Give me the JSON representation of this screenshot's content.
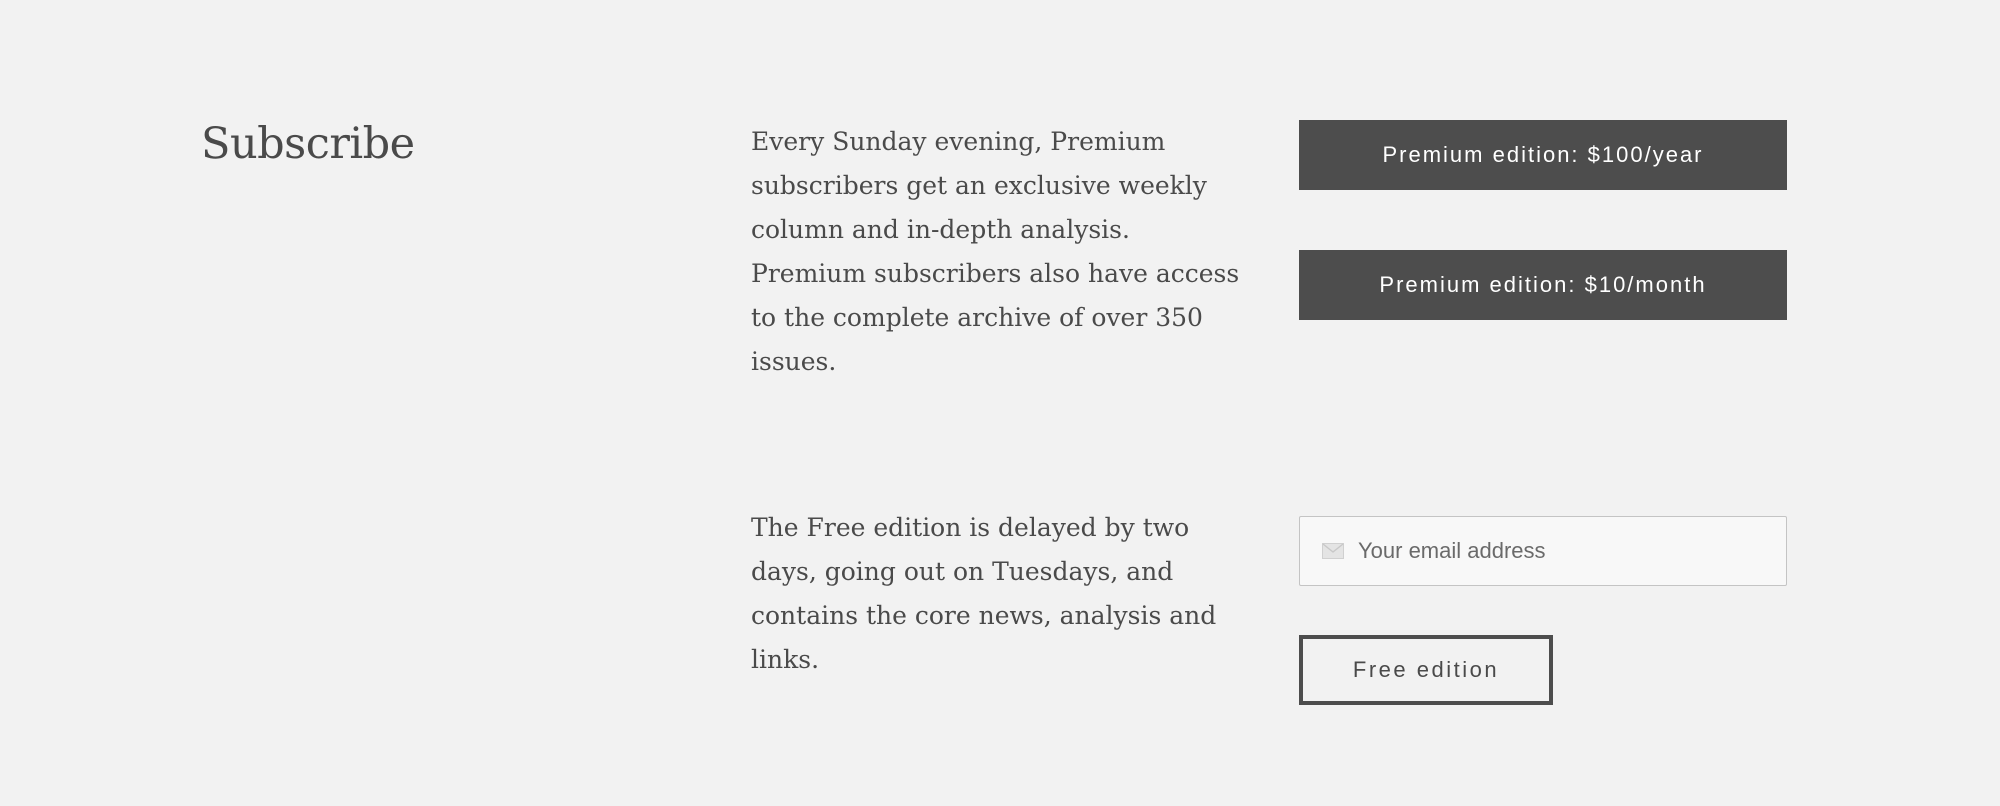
{
  "section": {
    "title": "Subscribe"
  },
  "premium": {
    "description": "Every Sunday evening, Premium subscribers get an exclusive weekly column and in-depth analysis. Premium subscribers also have access to the complete archive of over 350 issues.",
    "yearly_button_label": "Premium edition: $100/year",
    "monthly_button_label": "Premium edition: $10/month"
  },
  "free": {
    "description": "The Free edition is delayed by two days, going out on Tuesdays, and contains the core news, analysis and links.",
    "email_placeholder": "Your email address",
    "email_icon": "envelope-icon",
    "button_label": "Free edition"
  },
  "colors": {
    "background": "#f2f2f2",
    "text": "#4a4a4a",
    "button_fill": "#4d4d4d",
    "button_text": "#ffffff"
  }
}
